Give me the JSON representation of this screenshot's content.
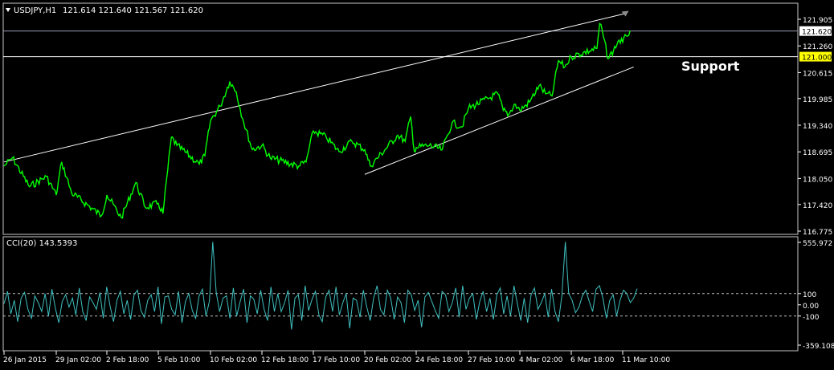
{
  "header": {
    "symbol_label": "USDJPY,H1",
    "ohlc_label": "121.614 121.640 121.567 121.620"
  },
  "annotations": {
    "support_label": "Support"
  },
  "indicator": {
    "label": "CCI(20) 143.5393"
  },
  "colors": {
    "background": "#000000",
    "price_line": "#00ff00",
    "cci_line": "#40c0c0",
    "channel_line": "#ffffff",
    "axis": "#ffffff",
    "current_price_tag": "#ffffff",
    "support_tag": "#ffff00",
    "level_dash": "#c0c0c0"
  },
  "chart_data": [
    {
      "type": "line",
      "title": "USDJPY,H1",
      "ylim": [
        116.775,
        121.905
      ],
      "y_ticks": [
        "121.905",
        "121.260",
        "120.615",
        "119.985",
        "119.340",
        "118.695",
        "118.050",
        "117.420",
        "116.775"
      ],
      "x_ticks": [
        "26 Jan 2015",
        "29 Jan 02:00",
        "2 Feb 18:00",
        "5 Feb 10:00",
        "10 Feb 02:00",
        "12 Feb 18:00",
        "17 Feb 10:00",
        "20 Feb 02:00",
        "24 Feb 18:00",
        "27 Feb 10:00",
        "4 Mar 02:00",
        "6 Mar 18:00",
        "11 Mar 10:00"
      ],
      "current_price": "121.620",
      "support_level": "121.000",
      "keypoints": [
        {
          "x": "26 Jan 2015",
          "y": 118.35
        },
        {
          "x": "26 Jan 12:00",
          "y": 118.55
        },
        {
          "x": "27 Jan 12:00",
          "y": 117.85
        },
        {
          "x": "28 Jan 12:00",
          "y": 118.1
        },
        {
          "x": "29 Jan 02:00",
          "y": 117.65
        },
        {
          "x": "29 Jan 14:00",
          "y": 118.45
        },
        {
          "x": "30 Jan 12:00",
          "y": 117.7
        },
        {
          "x": "2 Feb 06:00",
          "y": 117.15
        },
        {
          "x": "2 Feb 18:00",
          "y": 117.65
        },
        {
          "x": "3 Feb 12:00",
          "y": 117.1
        },
        {
          "x": "4 Feb 06:00",
          "y": 117.95
        },
        {
          "x": "4 Feb 18:00",
          "y": 117.35
        },
        {
          "x": "5 Feb 10:00",
          "y": 117.45
        },
        {
          "x": "5 Feb 20:00",
          "y": 117.2
        },
        {
          "x": "6 Feb 14:00",
          "y": 119.05
        },
        {
          "x": "7 Feb 02:00",
          "y": 118.85
        },
        {
          "x": "9 Feb 02:00",
          "y": 118.4
        },
        {
          "x": "9 Feb 14:00",
          "y": 118.6
        },
        {
          "x": "10 Feb 02:00",
          "y": 119.45
        },
        {
          "x": "10 Feb 14:00",
          "y": 119.8
        },
        {
          "x": "11 Feb 02:00",
          "y": 120.4
        },
        {
          "x": "11 Feb 10:00",
          "y": 120.15
        },
        {
          "x": "11 Feb 18:00",
          "y": 119.5
        },
        {
          "x": "12 Feb 06:00",
          "y": 118.75
        },
        {
          "x": "12 Feb 18:00",
          "y": 118.85
        },
        {
          "x": "13 Feb 12:00",
          "y": 118.55
        },
        {
          "x": "16 Feb 02:00",
          "y": 118.35
        },
        {
          "x": "16 Feb 18:00",
          "y": 118.45
        },
        {
          "x": "17 Feb 10:00",
          "y": 119.2
        },
        {
          "x": "18 Feb 02:00",
          "y": 119.05
        },
        {
          "x": "18 Feb 18:00",
          "y": 118.7
        },
        {
          "x": "19 Feb 10:00",
          "y": 118.95
        },
        {
          "x": "20 Feb 02:00",
          "y": 118.75
        },
        {
          "x": "20 Feb 14:00",
          "y": 118.35
        },
        {
          "x": "23 Feb 02:00",
          "y": 119.1
        },
        {
          "x": "23 Feb 18:00",
          "y": 118.95
        },
        {
          "x": "24 Feb 06:00",
          "y": 119.55
        },
        {
          "x": "24 Feb 14:00",
          "y": 118.7
        },
        {
          "x": "24 Feb 18:00",
          "y": 118.8
        },
        {
          "x": "25 Feb 10:00",
          "y": 118.85
        },
        {
          "x": "26 Feb 02:00",
          "y": 118.75
        },
        {
          "x": "26 Feb 14:00",
          "y": 119.4
        },
        {
          "x": "27 Feb 02:00",
          "y": 119.3
        },
        {
          "x": "27 Feb 10:00",
          "y": 119.75
        },
        {
          "x": "2 Mar 02:00",
          "y": 120.1
        },
        {
          "x": "2 Mar 14:00",
          "y": 119.7
        },
        {
          "x": "3 Mar 02:00",
          "y": 119.6
        },
        {
          "x": "3 Mar 14:00",
          "y": 119.85
        },
        {
          "x": "4 Mar 02:00",
          "y": 119.7
        },
        {
          "x": "4 Mar 14:00",
          "y": 119.9
        },
        {
          "x": "5 Mar 02:00",
          "y": 120.3
        },
        {
          "x": "5 Mar 10:00",
          "y": 120.1
        },
        {
          "x": "5 Mar 18:00",
          "y": 120.05
        },
        {
          "x": "6 Mar 02:00",
          "y": 120.9
        },
        {
          "x": "6 Mar 10:00",
          "y": 120.75
        },
        {
          "x": "6 Mar 18:00",
          "y": 121.0
        },
        {
          "x": "9 Mar 02:00",
          "y": 121.2
        },
        {
          "x": "9 Mar 08:00",
          "y": 121.8
        },
        {
          "x": "9 Mar 14:00",
          "y": 121.6
        },
        {
          "x": "10 Mar 02:00",
          "y": 120.95
        },
        {
          "x": "10 Mar 14:00",
          "y": 121.15
        },
        {
          "x": "11 Mar 02:00",
          "y": 121.4
        },
        {
          "x": "11 Mar 10:00",
          "y": 121.35
        },
        {
          "x": "11 Mar 18:00",
          "y": 121.5
        },
        {
          "x": "12 Mar 02:00",
          "y": 121.62
        }
      ],
      "channel_upper": [
        {
          "x": "26 Jan 2015",
          "y": 118.45
        },
        {
          "x": "11 Mar 18:00",
          "y": 122.05
        }
      ],
      "channel_lower": [
        {
          "x": "20 Feb 02:00",
          "y": 118.15
        },
        {
          "x": "12 Mar 10:00",
          "y": 120.75
        }
      ]
    },
    {
      "type": "line",
      "title": "CCI(20) 143.5393",
      "ylim": [
        -359.1081,
        555.972
      ],
      "y_ticks": [
        "555.972",
        "100",
        "0.00",
        "-100",
        "-359.1081"
      ],
      "levels": [
        100,
        -100
      ],
      "series": [
        {
          "values": [
            10,
            120,
            -80,
            40,
            -150,
            60,
            110,
            -40,
            -120,
            80,
            20,
            -60,
            100,
            -100,
            140,
            -30,
            -160,
            30,
            90,
            -20,
            60,
            -90,
            150,
            -60,
            -140,
            70,
            20,
            -40,
            110,
            -120,
            160,
            -10,
            -150,
            40,
            120,
            -80,
            40,
            -130,
            90,
            130,
            -50,
            -110,
            40,
            90,
            -60,
            160,
            -170,
            70,
            80,
            -40,
            -90,
            120,
            -160,
            30,
            100,
            -50,
            -120,
            80,
            140,
            -100,
            30,
            560,
            110,
            -60,
            60,
            80,
            -120,
            150,
            -100,
            30,
            140,
            -160,
            80,
            50,
            -80,
            130,
            -40,
            -140,
            160,
            -60,
            100,
            -60,
            20,
            130,
            -220,
            60,
            90,
            -140,
            170,
            -50,
            50,
            120,
            -90,
            -150,
            70,
            130,
            -60,
            160,
            -90,
            20,
            100,
            -210,
            60,
            40,
            -110,
            130,
            -20,
            -140,
            60,
            170,
            -40,
            -90,
            130,
            60,
            -130,
            70,
            20,
            -160,
            130,
            90,
            -50,
            40,
            -200,
            70,
            110,
            30,
            -50,
            -120,
            120,
            90,
            -60,
            20,
            150,
            -110,
            170,
            -40,
            60,
            100,
            -130,
            30,
            120,
            -60,
            60,
            -130,
            90,
            150,
            -80,
            80,
            -100,
            170,
            10,
            -140,
            60,
            -160,
            90,
            150,
            -40,
            20,
            100,
            -110,
            140,
            -60,
            -150,
            80,
            560,
            100,
            40,
            -70,
            -20,
            80,
            130,
            30,
            -60,
            140,
            170,
            60,
            -120,
            40,
            90,
            -100,
            40,
            130,
            100,
            20,
            60,
            143.5393
          ]
        }
      ]
    }
  ]
}
